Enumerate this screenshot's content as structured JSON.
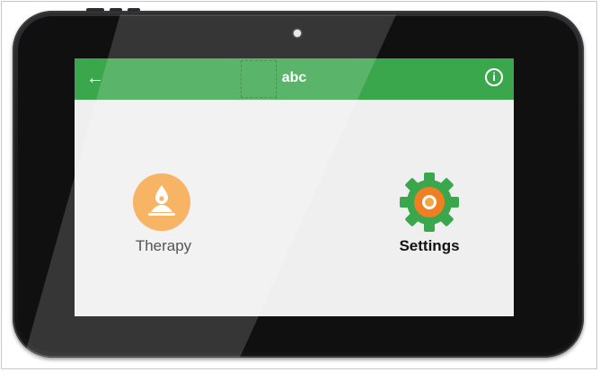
{
  "appbar": {
    "title": "abc",
    "back_icon": "arrow-left-icon",
    "info_icon": "info-icon",
    "info_glyph": "i",
    "color": "#3aa74d"
  },
  "tiles": [
    {
      "label": "Therapy",
      "icon": "therapy-icon",
      "color": "#f4a646"
    },
    {
      "label": "Settings",
      "icon": "gear-icon",
      "color": "#3aa74d",
      "accent": "#f07e22"
    }
  ],
  "device": {
    "frame_color": "#1b1b1c"
  }
}
